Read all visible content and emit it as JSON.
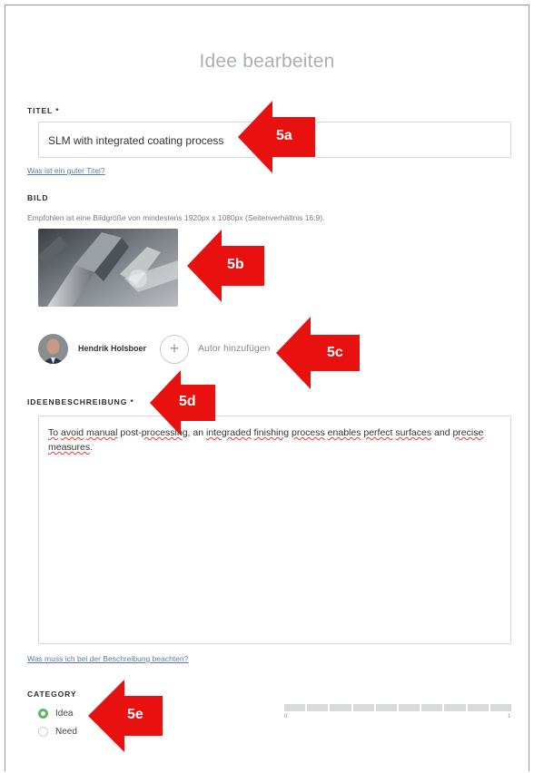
{
  "page": {
    "title": "Idee bearbeiten"
  },
  "title_field": {
    "label": "TITEL *",
    "value": "SLM with integrated coating process",
    "help_link": "Was ist ein guter Titel?"
  },
  "image_field": {
    "label": "BILD",
    "hint": "Empfohlen ist eine Bildgröße von mindestens 1920px x 1080px (Seitenverhältnis 16:9)."
  },
  "authors": {
    "author_name": "Hendrik Holsboer",
    "add_label": "Autor hinzufügen",
    "add_symbol": "+"
  },
  "description_field": {
    "label": "IDEENBESCHREIBUNG *",
    "help_link": "Was muss ich bei der Beschreibung beachten?",
    "words": [
      {
        "t": "To",
        "err": true
      },
      {
        "t": " "
      },
      {
        "t": "avoid",
        "err": true
      },
      {
        "t": " "
      },
      {
        "t": "manual",
        "err": true
      },
      {
        "t": " post-"
      },
      {
        "t": "processing",
        "err": true
      },
      {
        "t": ", an "
      },
      {
        "t": "integraded",
        "err": true
      },
      {
        "t": " "
      },
      {
        "t": "finishing",
        "err": true
      },
      {
        "t": " "
      },
      {
        "t": "process",
        "err": true
      },
      {
        "t": " "
      },
      {
        "t": "enables",
        "err": true
      },
      {
        "t": " "
      },
      {
        "t": "perfect",
        "err": true
      },
      {
        "t": " "
      },
      {
        "t": "surfaces",
        "err": true
      },
      {
        "t": " and "
      },
      {
        "t": "precise",
        "err": true
      },
      {
        "t": " "
      },
      {
        "t": "measures",
        "err": true
      },
      {
        "t": "."
      }
    ]
  },
  "category": {
    "label": "CATEGORY",
    "options": [
      {
        "label": "Idea",
        "selected": true
      },
      {
        "label": "Need",
        "selected": false
      }
    ]
  },
  "slider": {
    "min_label": "0",
    "max_label": "1",
    "segments": 10
  },
  "annotations": [
    "5a",
    "5b",
    "5c",
    "5d",
    "5e"
  ],
  "colors": {
    "annotation": "#e8110f",
    "radio_selected": "#5cb85c",
    "link": "#5a7f99"
  }
}
